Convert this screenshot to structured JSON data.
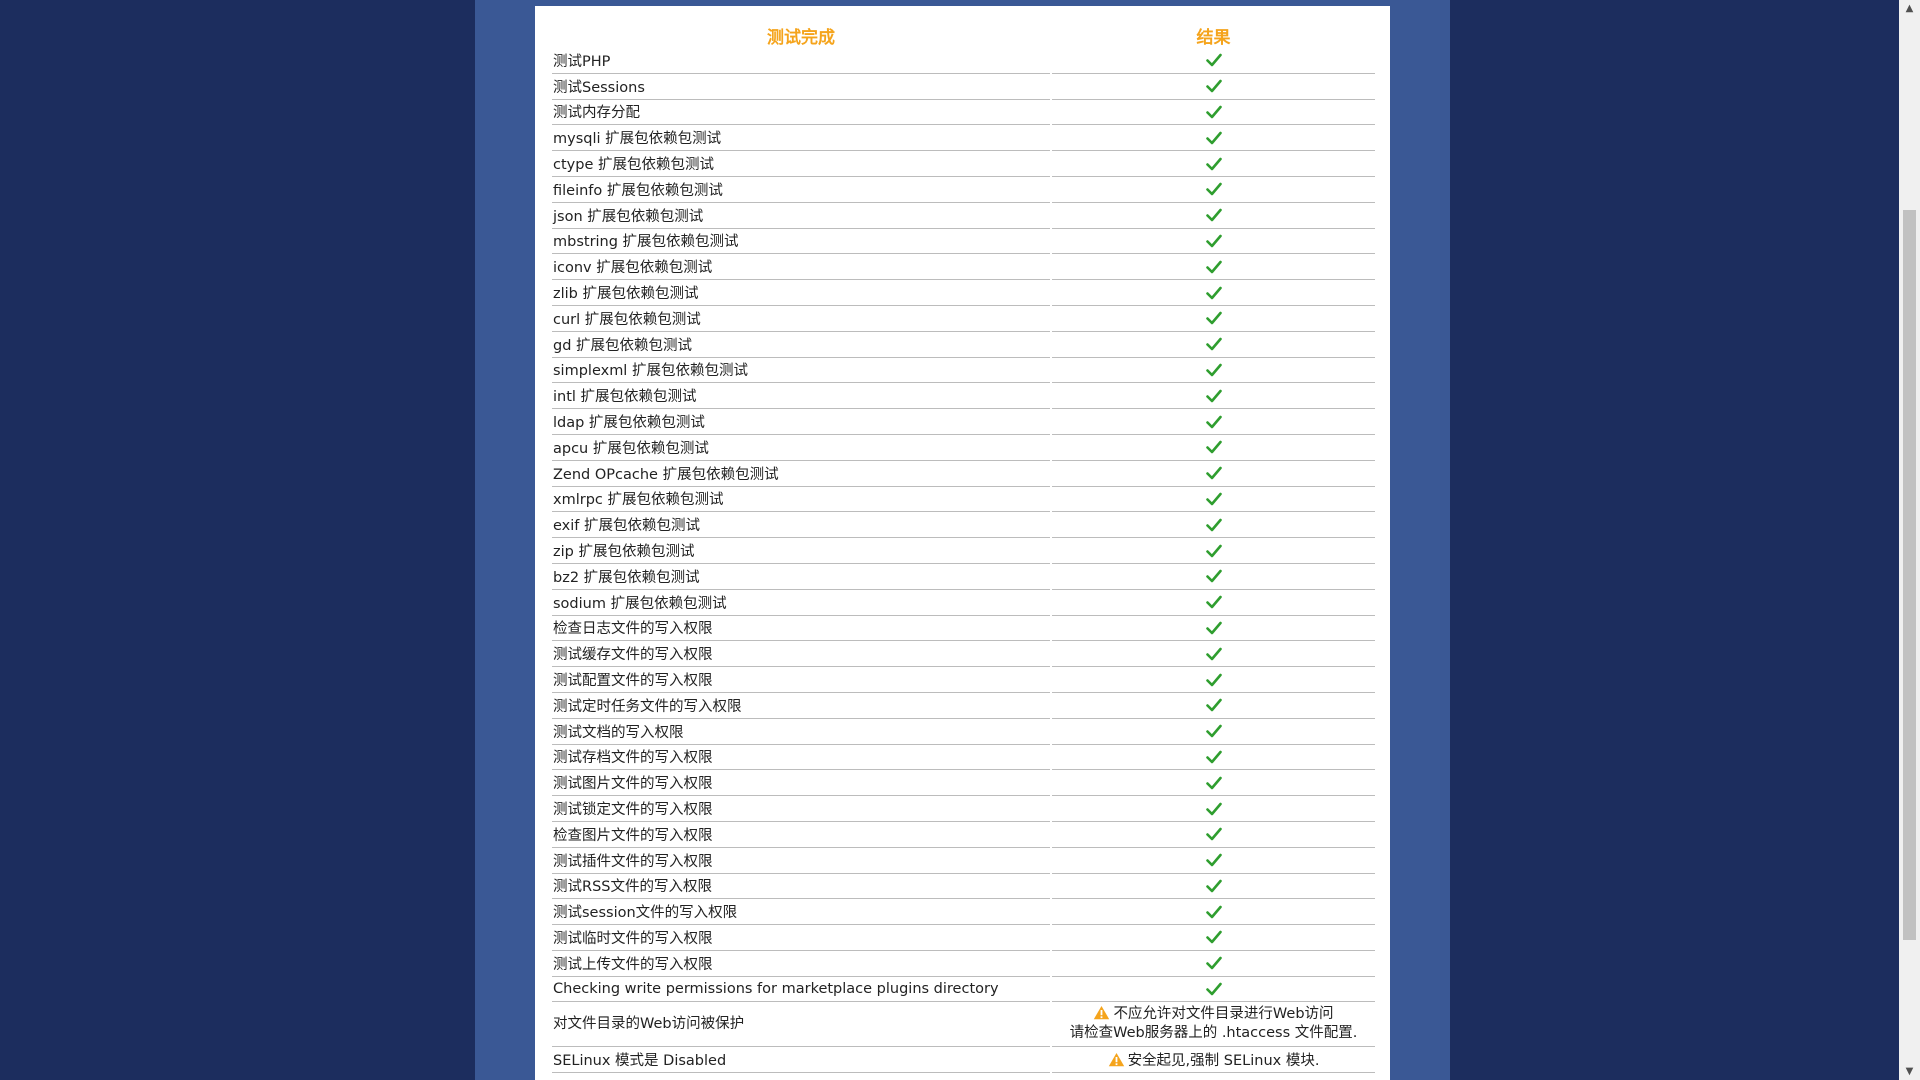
{
  "header": {
    "test_col": "测试完成",
    "result_col": "结果"
  },
  "colors": {
    "header": "#f5a41c",
    "check": "#2f9e2f",
    "warning": "#f5a41c",
    "page_bg": "#1c2d5e",
    "band_bg": "#3a5895"
  },
  "rows": [
    {
      "label": "测试PHP",
      "status": "ok"
    },
    {
      "label": "测试Sessions",
      "status": "ok"
    },
    {
      "label": "测试内存分配",
      "status": "ok"
    },
    {
      "label": "mysqli 扩展包依赖包测试",
      "status": "ok"
    },
    {
      "label": "ctype 扩展包依赖包测试",
      "status": "ok"
    },
    {
      "label": "fileinfo 扩展包依赖包测试",
      "status": "ok"
    },
    {
      "label": "json 扩展包依赖包测试",
      "status": "ok"
    },
    {
      "label": "mbstring 扩展包依赖包测试",
      "status": "ok"
    },
    {
      "label": "iconv 扩展包依赖包测试",
      "status": "ok"
    },
    {
      "label": "zlib 扩展包依赖包测试",
      "status": "ok"
    },
    {
      "label": "curl 扩展包依赖包测试",
      "status": "ok"
    },
    {
      "label": "gd 扩展包依赖包测试",
      "status": "ok"
    },
    {
      "label": "simplexml 扩展包依赖包测试",
      "status": "ok"
    },
    {
      "label": "intl 扩展包依赖包测试",
      "status": "ok"
    },
    {
      "label": "ldap 扩展包依赖包测试",
      "status": "ok"
    },
    {
      "label": "apcu 扩展包依赖包测试",
      "status": "ok"
    },
    {
      "label": "Zend OPcache 扩展包依赖包测试",
      "status": "ok"
    },
    {
      "label": "xmlrpc 扩展包依赖包测试",
      "status": "ok"
    },
    {
      "label": "exif 扩展包依赖包测试",
      "status": "ok"
    },
    {
      "label": "zip 扩展包依赖包测试",
      "status": "ok"
    },
    {
      "label": "bz2 扩展包依赖包测试",
      "status": "ok"
    },
    {
      "label": "sodium 扩展包依赖包测试",
      "status": "ok"
    },
    {
      "label": "检查日志文件的写入权限",
      "status": "ok"
    },
    {
      "label": "测试缓存文件的写入权限",
      "status": "ok"
    },
    {
      "label": "测试配置文件的写入权限",
      "status": "ok"
    },
    {
      "label": "测试定时任务文件的写入权限",
      "status": "ok"
    },
    {
      "label": "测试文档的写入权限",
      "status": "ok"
    },
    {
      "label": "测试存档文件的写入权限",
      "status": "ok"
    },
    {
      "label": "测试图片文件的写入权限",
      "status": "ok"
    },
    {
      "label": "测试锁定文件的写入权限",
      "status": "ok"
    },
    {
      "label": "检查图片文件的写入权限",
      "status": "ok"
    },
    {
      "label": "测试插件文件的写入权限",
      "status": "ok"
    },
    {
      "label": "测试RSS文件的写入权限",
      "status": "ok"
    },
    {
      "label": "测试session文件的写入权限",
      "status": "ok"
    },
    {
      "label": "测试临时文件的写入权限",
      "status": "ok"
    },
    {
      "label": "测试上传文件的写入权限",
      "status": "ok"
    },
    {
      "label": "Checking write permissions for marketplace plugins directory",
      "status": "ok"
    },
    {
      "label": "对文件目录的Web访问被保护",
      "status": "warning",
      "message": [
        "不应允许对文件目录进行Web访问",
        "请检查Web服务器上的 .htaccess 文件配置."
      ]
    },
    {
      "label": "SELinux 模式是 Disabled",
      "status": "warning",
      "message": [
        "安全起见,强制 SELinux 模块."
      ]
    }
  ]
}
